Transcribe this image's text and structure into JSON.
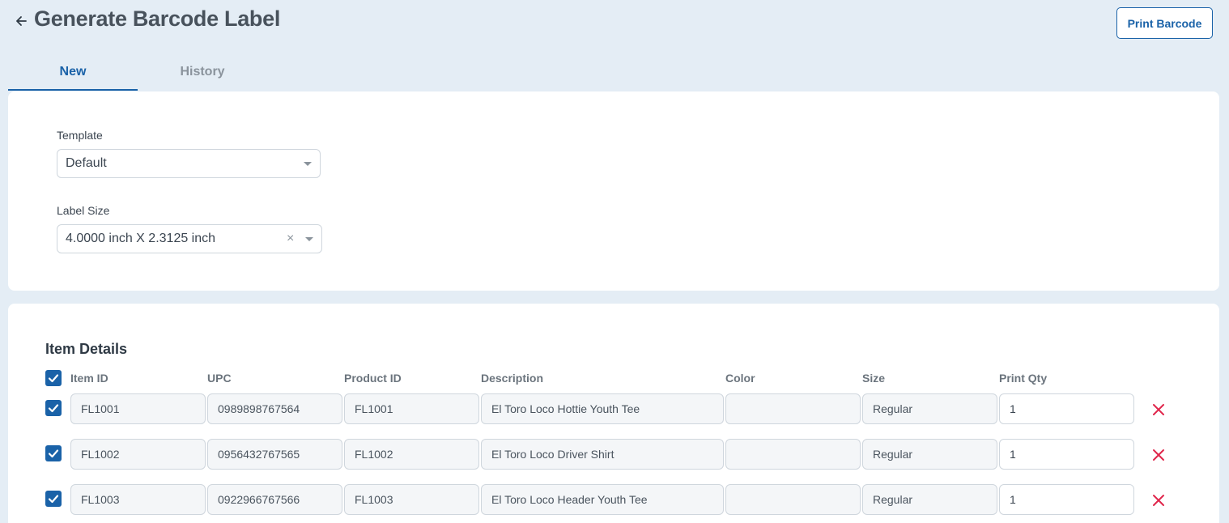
{
  "header": {
    "title": "Generate Barcode Label",
    "print_button": "Print Barcode"
  },
  "tabs": [
    {
      "label": "New",
      "active": true
    },
    {
      "label": "History",
      "active": false
    }
  ],
  "form": {
    "template_label": "Template",
    "template_value": "Default",
    "label_size_label": "Label Size",
    "label_size_value": "4.0000 inch X 2.3125 inch",
    "clear_glyph": "×"
  },
  "items": {
    "title": "Item Details",
    "select_all_checked": true,
    "columns": [
      "Item ID",
      "UPC",
      "Product ID",
      "Description",
      "Color",
      "Size",
      "Print Qty"
    ],
    "rows": [
      {
        "checked": true,
        "item_id": "FL1001",
        "upc": "0989898767564",
        "product_id": "FL1001",
        "description": "El Toro Loco Hottie Youth Tee",
        "color": "",
        "size": "Regular",
        "qty": "1"
      },
      {
        "checked": true,
        "item_id": "FL1002",
        "upc": "0956432767565",
        "product_id": "FL1002",
        "description": "El Toro Loco Driver Shirt",
        "color": "",
        "size": "Regular",
        "qty": "1"
      },
      {
        "checked": true,
        "item_id": "FL1003",
        "upc": "0922966767566",
        "product_id": "FL1003",
        "description": "El Toro Loco Header Youth Tee",
        "color": "",
        "size": "Regular",
        "qty": "1"
      }
    ]
  },
  "colors": {
    "accent": "#1a62a8",
    "delete": "#e0264b",
    "background": "#e4edf5"
  }
}
